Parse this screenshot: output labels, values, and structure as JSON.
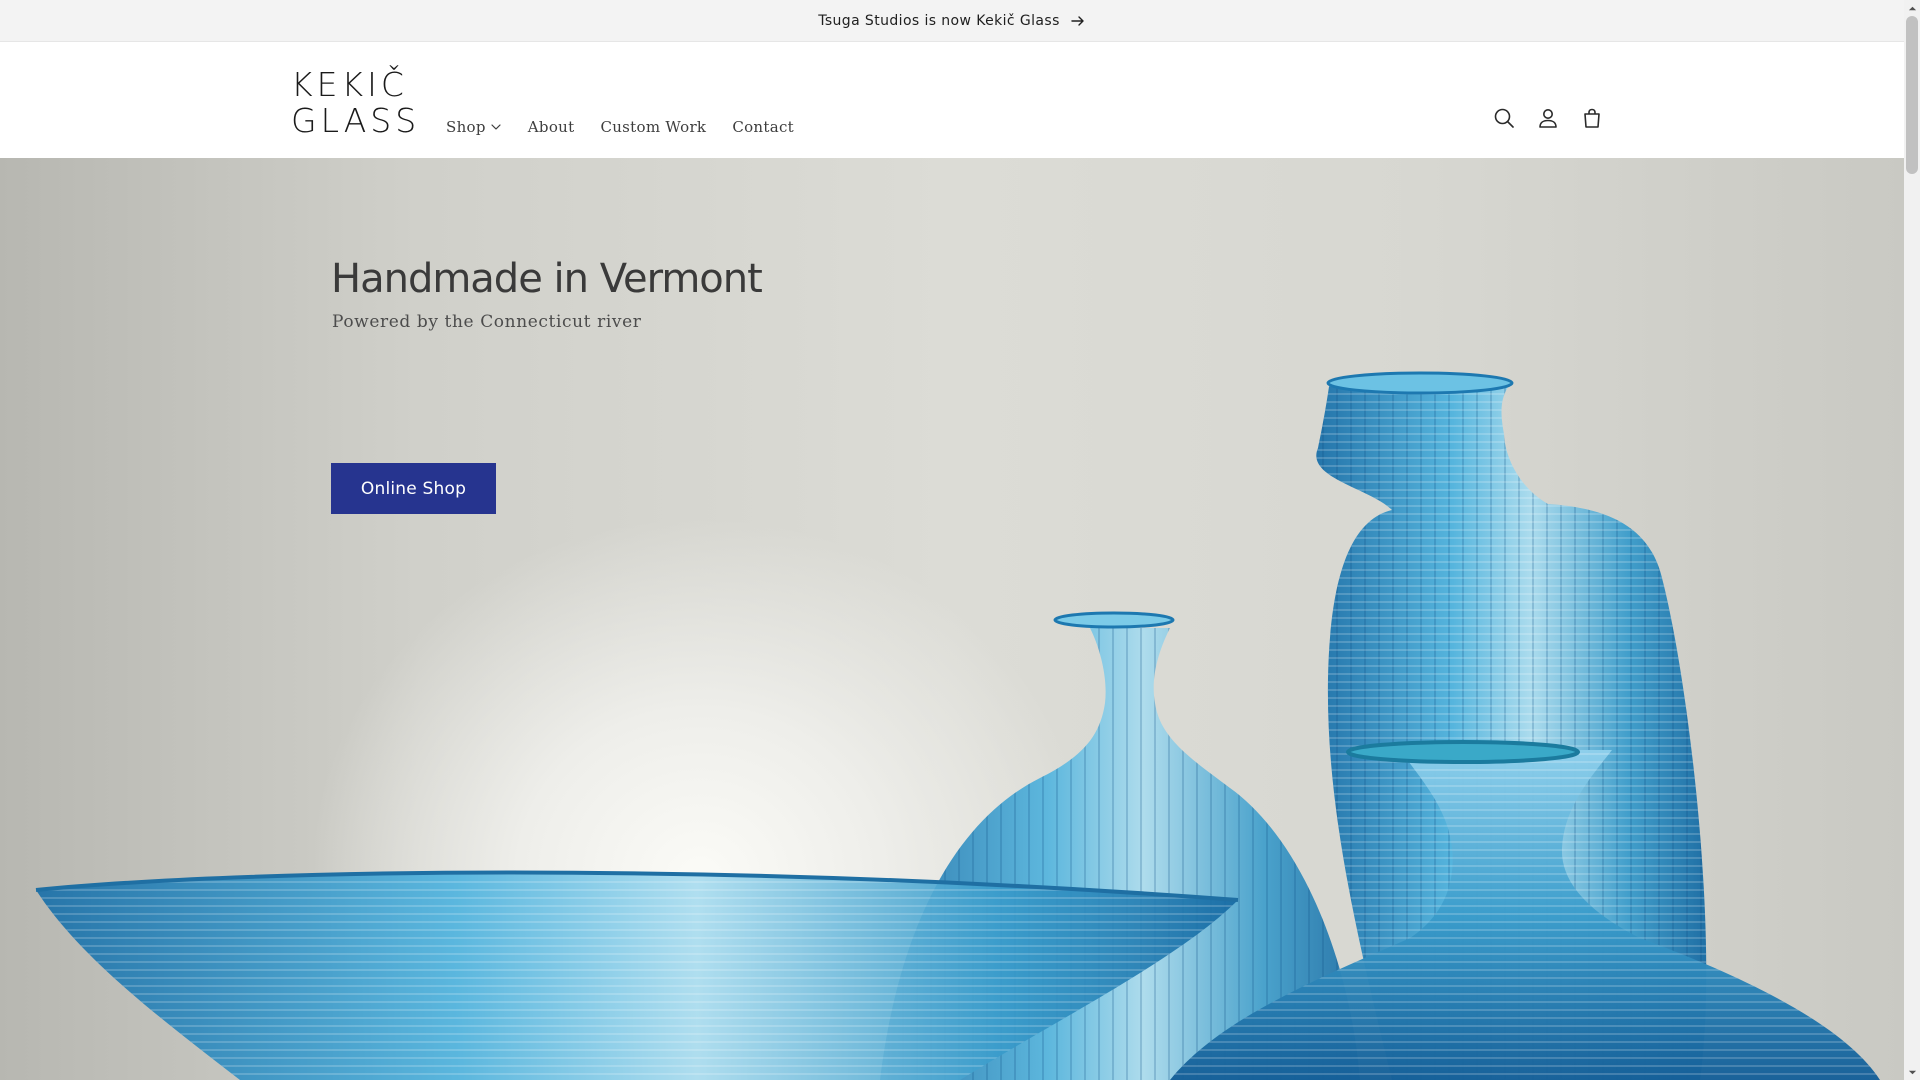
{
  "announcement": {
    "text": "Tsuga Studios is now Kekič Glass",
    "icon": "arrow-right-icon"
  },
  "header": {
    "logo": {
      "line1": "KEKIČ",
      "line2": "GLASS"
    },
    "nav": [
      {
        "label": "Shop",
        "has_dropdown": true
      },
      {
        "label": "About"
      },
      {
        "label": "Custom Work"
      },
      {
        "label": "Contact"
      }
    ],
    "icons": [
      "search-icon",
      "account-icon",
      "cart-icon"
    ]
  },
  "hero": {
    "title": "Handmade in Vermont",
    "subtitle": "Powered by the Connecticut river",
    "button_label": "Online Shop",
    "button_color": "#26348f",
    "glass_color": "#2e9fd0"
  }
}
